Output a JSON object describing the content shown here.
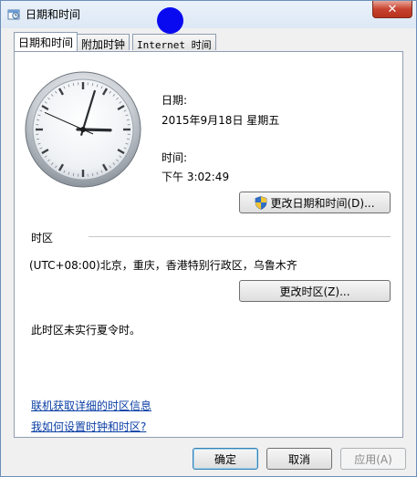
{
  "window": {
    "title": "日期和时间",
    "close_label": "✕"
  },
  "tabs": [
    {
      "label": "日期和时间",
      "active": true
    },
    {
      "label": "附加时钟",
      "active": false
    },
    {
      "label": "Internet 时间",
      "active": false
    }
  ],
  "clock": {
    "hours": 3,
    "minutes": 2,
    "seconds": 49
  },
  "datetime": {
    "date_label": "日期:",
    "date_value": "2015年9月18日 星期五",
    "time_label": "时间:",
    "time_value": "下午 3:02:49",
    "change_datetime_button": "更改日期和时间(D)..."
  },
  "timezone": {
    "section_label": "时区",
    "value": "(UTC+08:00)北京，重庆，香港特别行政区，乌鲁木齐",
    "change_timezone_button": "更改时区(Z)...",
    "dst_note": "此时区未实行夏令时。"
  },
  "links": {
    "online_info": "联机获取详细的时区信息",
    "how_to_set": "我如何设置时钟和时区?"
  },
  "footer": {
    "ok": "确定",
    "cancel": "取消",
    "apply": "应用(A)"
  },
  "colors": {
    "link": "#0b3fa5",
    "cursor_marker": "#0a0af0"
  }
}
